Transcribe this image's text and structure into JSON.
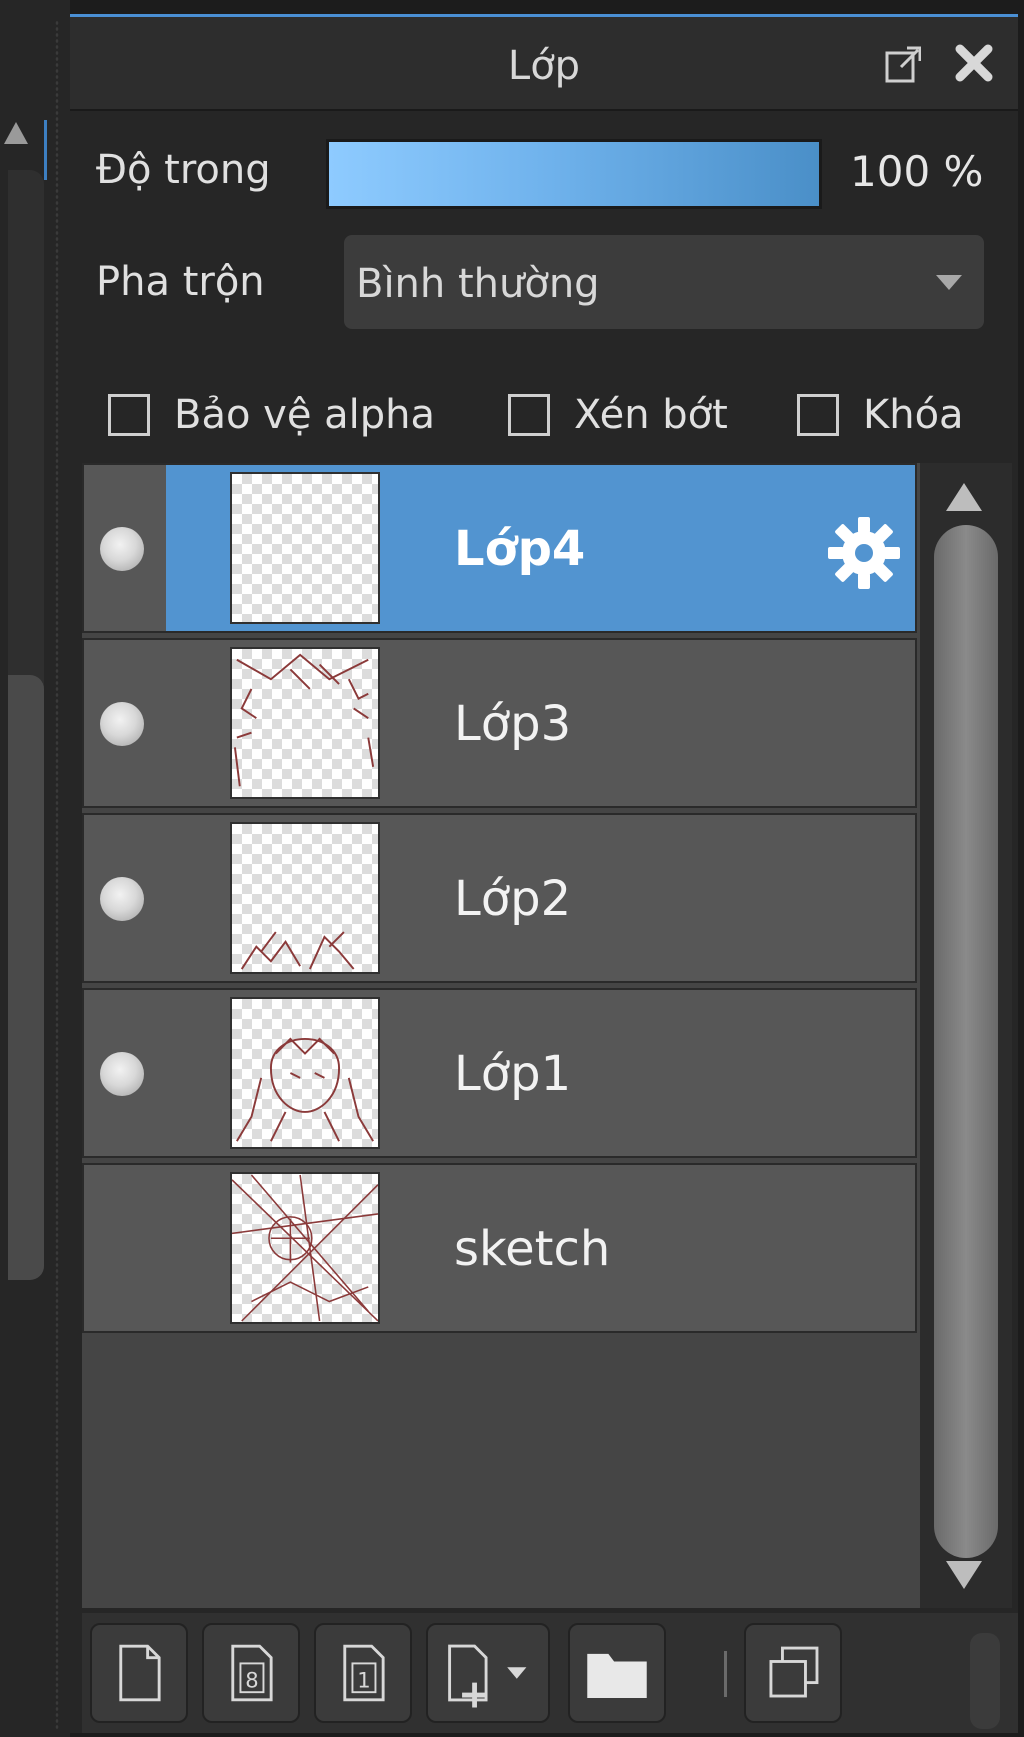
{
  "panel": {
    "title": "Lớp",
    "popout_icon": "popout-icon",
    "close_icon": "close-icon"
  },
  "opacity": {
    "label": "Độ trong",
    "value": "100 %",
    "level": 1.0
  },
  "blend": {
    "label": "Pha trộn",
    "value": "Bình thường"
  },
  "options": {
    "alpha_protect": "Bảo vệ alpha",
    "clip": "Xén bớt",
    "lock": "Khóa"
  },
  "layers": [
    {
      "name": "Lớp4",
      "selected": true,
      "visible_dot": true,
      "has_gear": true
    },
    {
      "name": "Lớp3",
      "selected": false,
      "visible_dot": true,
      "has_gear": false
    },
    {
      "name": "Lớp2",
      "selected": false,
      "visible_dot": true,
      "has_gear": false
    },
    {
      "name": "Lớp1",
      "selected": false,
      "visible_dot": true,
      "has_gear": false
    },
    {
      "name": "sketch",
      "selected": false,
      "visible_dot": false,
      "has_gear": false
    }
  ],
  "toolbar": {
    "buttons": [
      "new-layer-icon",
      "new-8bit-layer-icon",
      "new-1bit-layer-icon",
      "add-layer-menu-icon",
      "new-folder-icon",
      "duplicate-layer-icon"
    ]
  },
  "colors": {
    "accent": "#5294d0",
    "sketch_line": "#8b3a3a"
  }
}
